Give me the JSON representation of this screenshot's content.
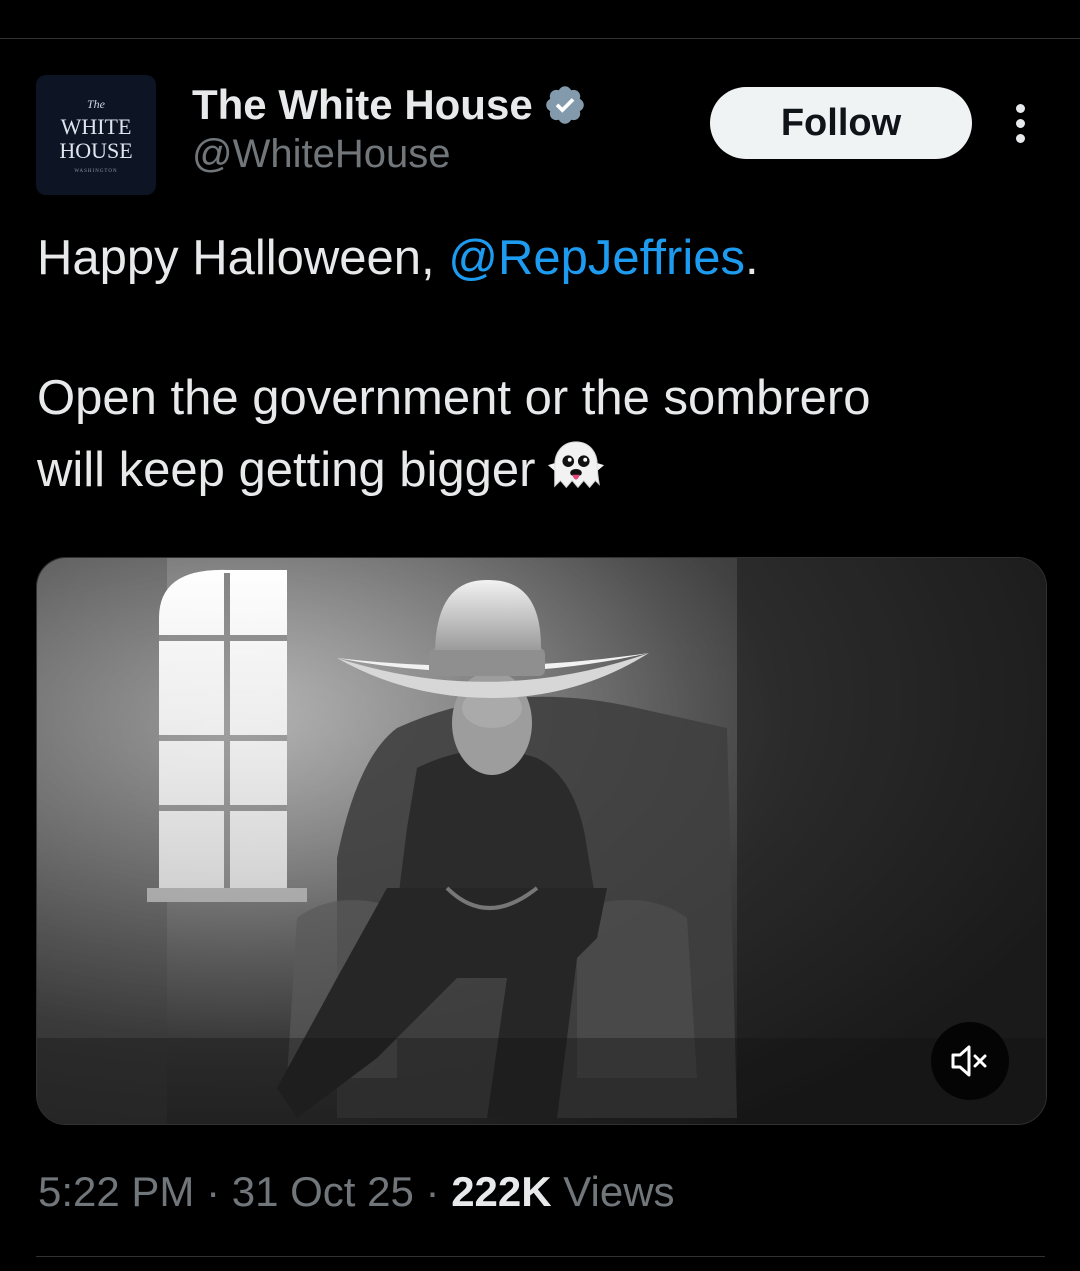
{
  "author": {
    "display_name": "The White House",
    "handle": "@WhiteHouse",
    "avatar_text": {
      "top": "The",
      "line1": "WHITE",
      "line2": "HOUSE",
      "bottom": "WASHINGTON"
    }
  },
  "actions": {
    "follow_label": "Follow",
    "more_icon": "more-vertical-icon"
  },
  "tweet": {
    "line1_prefix": "Happy Halloween, ",
    "mention": "@RepJeffries",
    "line1_suffix": ".",
    "line2": "Open the government or the sombrero",
    "line3": "will keep getting bigger",
    "emoji": "ghost"
  },
  "media": {
    "type": "video",
    "mute_icon": "speaker-muted-icon"
  },
  "meta": {
    "time": "5:22 PM",
    "sep1": " · ",
    "date": "31 Oct 25",
    "sep2": " · ",
    "views_count": "222K",
    "views_label": " Views"
  },
  "colors": {
    "background": "#000000",
    "text": "#e7e9ea",
    "secondary_text": "#71767b",
    "link": "#1d9bf0",
    "verified_badge": "#829aab",
    "follow_button_bg": "#eff3f4"
  }
}
